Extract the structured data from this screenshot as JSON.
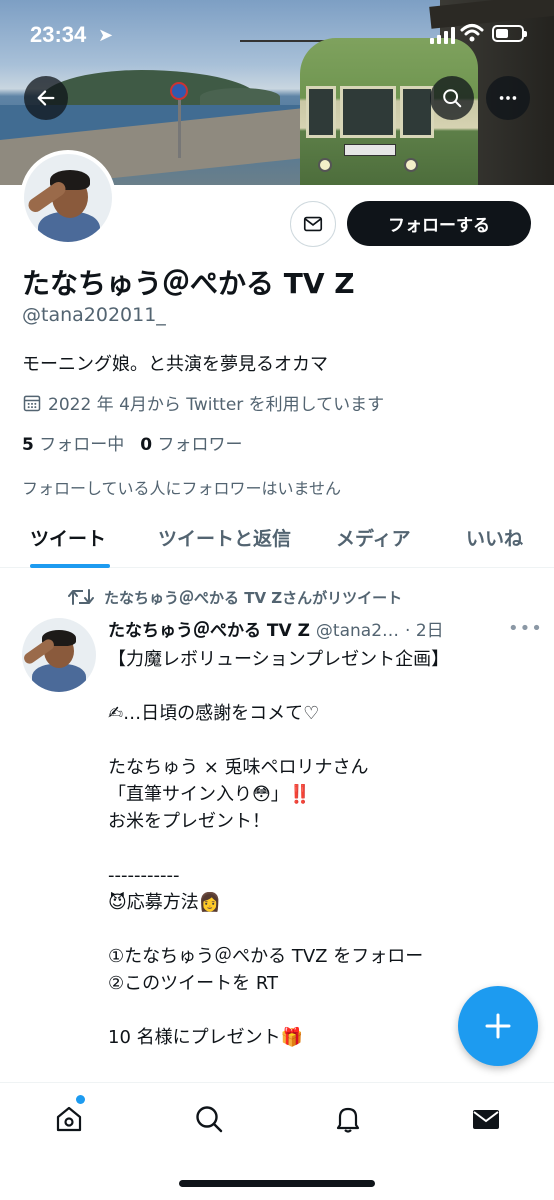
{
  "status_bar": {
    "time": "23:34"
  },
  "profile": {
    "name": "たなちゅう＠ぺかる TV Z",
    "handle": "@tana202011_",
    "bio": "モーニング娘。と共演を夢見るオカマ",
    "joined": "2022 年 4月から Twitter を利用しています",
    "following_count": "5",
    "following_label": "フォロー中",
    "followers_count": "0",
    "followers_label": "フォロワー",
    "no_mutual": "フォローしている人にフォロワーはいません",
    "follow_button": "フォローする"
  },
  "tabs": [
    "ツイート",
    "ツイートと返信",
    "メディア",
    "いいね"
  ],
  "tweet": {
    "retweet_by": "たなちゅう＠ぺかる TV Zさんがリツイート",
    "author_name": "たなちゅう＠ぺかる TV Z",
    "author_handle": "@tana2…",
    "time": "· 2日",
    "lines": [
      "【力魔レボリューションプレゼント企画】",
      "",
      "✍…日頃の感謝をコメて♡",
      "",
      "たなちゅう × 兎味ペロリナさん",
      "「直筆サイン入り😳」‼️",
      "お米をプレゼント！",
      "",
      "-----------",
      "😈応募方法👩",
      "",
      "①たなちゅう＠ぺかる TVZ をフォロー",
      "②このツイートを RT",
      "",
      "10 名様にプレゼント🎁"
    ]
  },
  "icons": {
    "back": "arrow-left-icon",
    "search": "search-icon",
    "more": "more-icon",
    "message": "envelope-icon",
    "calendar": "calendar-icon",
    "retweet": "retweet-icon",
    "compose": "plus-icon",
    "nav": [
      "home-icon",
      "search-icon",
      "bell-icon",
      "mail-icon"
    ]
  },
  "colors": {
    "accent": "#1d9bf0",
    "text": "#0f1419",
    "secondary": "#536471"
  }
}
